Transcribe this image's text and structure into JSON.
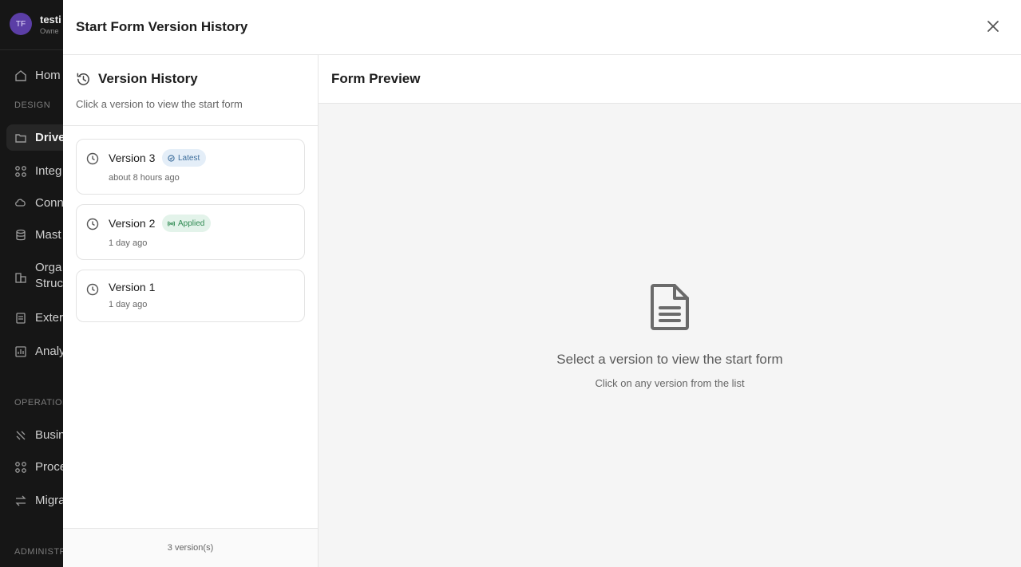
{
  "background_sidebar": {
    "user": {
      "initials": "TF",
      "name": "testi",
      "role": "Owne"
    },
    "items": [
      {
        "label": "Hom",
        "icon": "home-icon"
      },
      {
        "label": "Drive",
        "icon": "folder-icon"
      },
      {
        "label": "Integ",
        "icon": "integrations-icon"
      },
      {
        "label": "Conn",
        "icon": "connections-icon"
      },
      {
        "label": "Mast",
        "icon": "database-icon"
      },
      {
        "label": "Orga",
        "label2": "Struc",
        "icon": "org-structure-icon"
      },
      {
        "label": "Exter",
        "icon": "external-icon"
      },
      {
        "label": "Analy",
        "icon": "analytics-icon"
      },
      {
        "label": "Busin",
        "icon": "business-icon"
      },
      {
        "label": "Proce",
        "icon": "process-icon"
      },
      {
        "label": "Migra",
        "icon": "migration-icon"
      }
    ],
    "sections": {
      "design": "DESIGN",
      "operations": "OPERATION",
      "admin": "ADMINISTR"
    }
  },
  "modal": {
    "title": "Start Form Version History",
    "left_panel": {
      "title": "Version History",
      "subtitle": "Click a version to view the start form",
      "versions": [
        {
          "name": "Version 3",
          "time": "about 8 hours ago",
          "badge": "Latest"
        },
        {
          "name": "Version 2",
          "time": "1 day ago",
          "badge": "Applied"
        },
        {
          "name": "Version 1",
          "time": "1 day ago",
          "badge": ""
        }
      ],
      "footer": "3 version(s)"
    },
    "right_panel": {
      "title": "Form Preview",
      "empty_title": "Select a version to view the start form",
      "empty_subtitle": "Click on any version from the list"
    }
  },
  "colors": {
    "latest_badge_bg": "#e4eef8",
    "latest_badge_text": "#3d6e9c",
    "applied_badge_bg": "#e3f3ea",
    "applied_badge_text": "#2f8a52",
    "avatar": "#5b3ea6"
  }
}
